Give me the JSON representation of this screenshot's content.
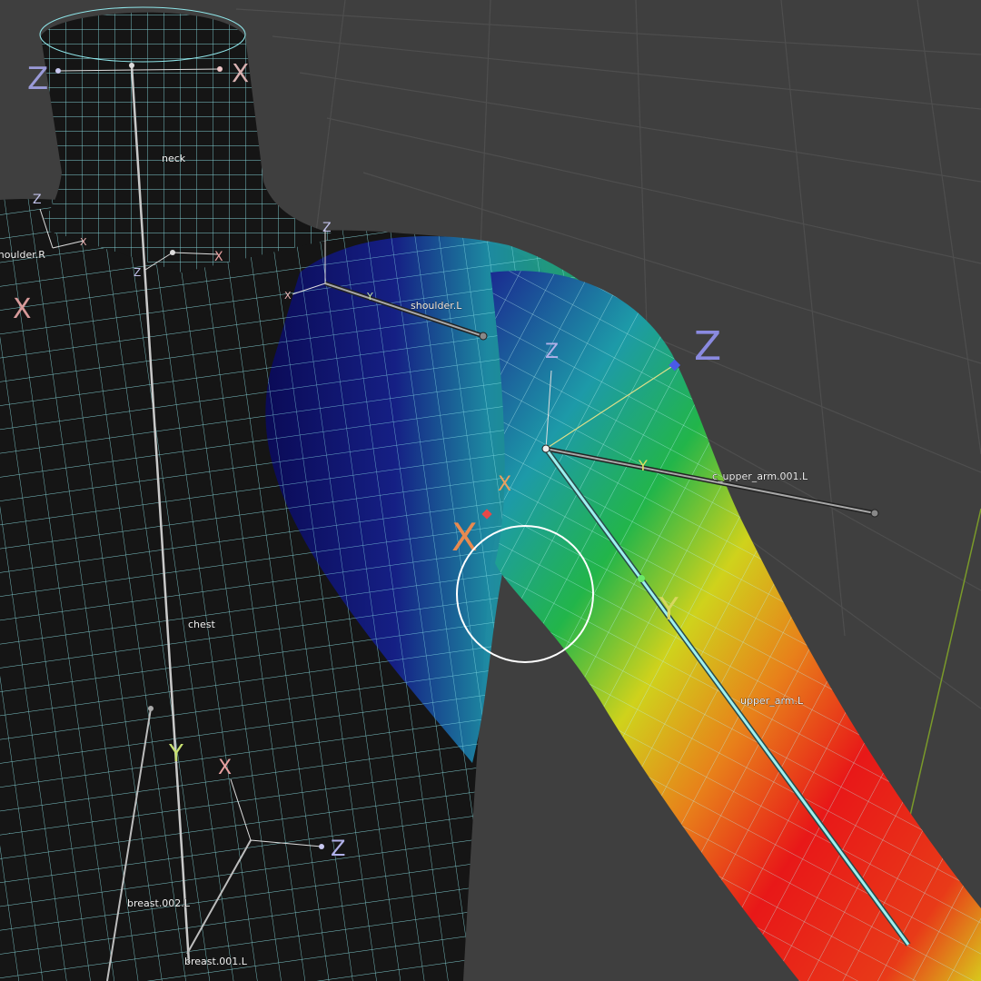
{
  "viewport": {
    "background": "#3f3f3f",
    "grid_color": "#4d4d4d",
    "mesh_wire_color": "#8fe6ea",
    "body_fill": "#151515"
  },
  "bones": {
    "neck": "neck",
    "shoulder_r": "shoulder.R",
    "shoulder_l": "shoulder.L",
    "c_upper_arm": "c_upper_arm.001.L",
    "chest": "chest",
    "upper_arm": "upper_arm.L",
    "breast_002": "breast.002.L",
    "breast_001": "breast.001.L"
  },
  "axis_labels": {
    "z": "Z",
    "x": "X",
    "y": "Y"
  },
  "weight_paint": {
    "gradient": [
      "#0a0a6a",
      "#1a3aa0",
      "#1d9aa8",
      "#22b54a",
      "#cfd21c",
      "#e8a21a",
      "#e85a18",
      "#e81818"
    ]
  },
  "brush_cursor": {
    "color": "#ffffff"
  },
  "icons": [
    "brush-cursor-icon",
    "bone-head-icon",
    "bone-tail-icon",
    "axis-gizmo-icon"
  ]
}
